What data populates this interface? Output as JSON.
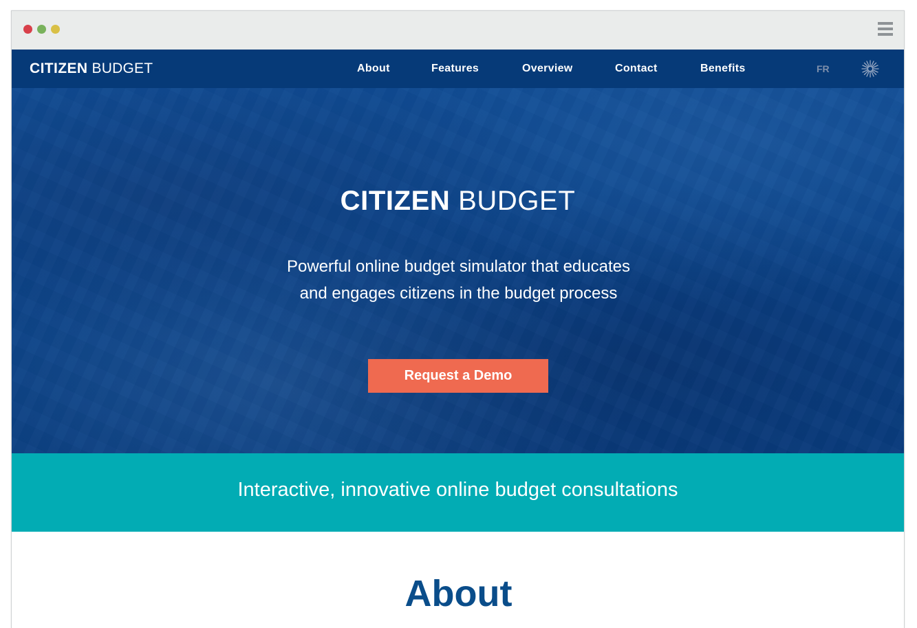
{
  "window": {
    "menu_icon": "hamburger-menu-icon"
  },
  "nav": {
    "logo_bold": "CITIZEN",
    "logo_light": "BUDGET",
    "items": [
      {
        "label": "About"
      },
      {
        "label": "Features"
      },
      {
        "label": "Overview"
      },
      {
        "label": "Contact"
      },
      {
        "label": "Benefits"
      }
    ],
    "lang": "FR",
    "brand_icon": "star-burst-icon"
  },
  "hero": {
    "title_bold": "CITIZEN",
    "title_light": "BUDGET",
    "subtitle_line1": "Powerful online budget simulator that educates",
    "subtitle_line2": "and engages citizens in the budget process",
    "cta": "Request a Demo"
  },
  "band": {
    "text": "Interactive, innovative online budget consultations"
  },
  "about": {
    "heading": "About"
  },
  "colors": {
    "nav_bg": "#063a78",
    "hero_bg": "#0b4388",
    "cta_bg": "#ef6a50",
    "band_bg": "#02acb4",
    "heading": "#0a4d8a"
  }
}
